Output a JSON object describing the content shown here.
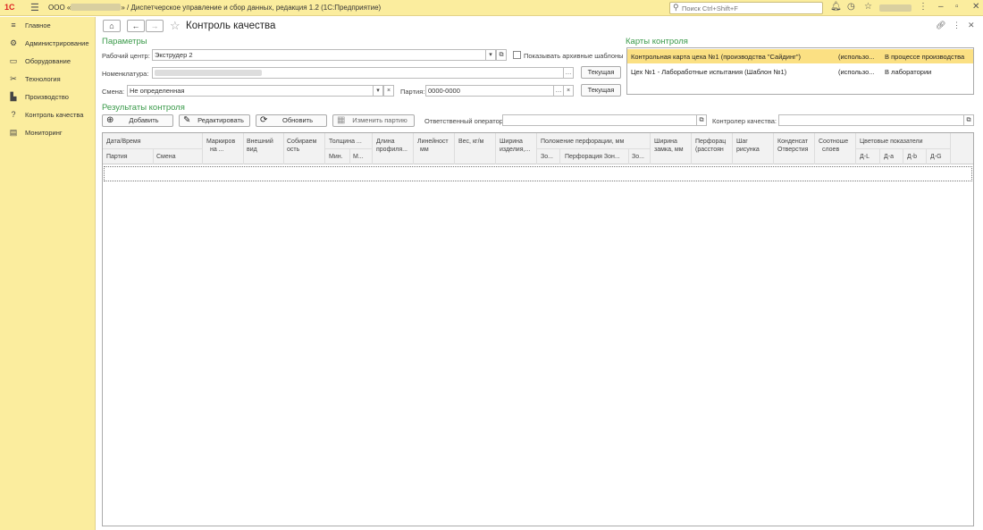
{
  "titlebar": {
    "logo": "1С",
    "title_prefix": "ООО «",
    "title_suffix": "» / Диспетчерское управление и сбор данных, редакция 1.2  (1С:Предприятие)",
    "search_placeholder": "Поиск Ctrl+Shift+F"
  },
  "sidebar": {
    "items": [
      {
        "label": "Главное",
        "icon": "menu-lines-icon"
      },
      {
        "label": "Администрирование",
        "icon": "gear-icon"
      },
      {
        "label": "Оборудование",
        "icon": "monitor-icon"
      },
      {
        "label": "Технология",
        "icon": "tools-icon"
      },
      {
        "label": "Производство",
        "icon": "factory-icon"
      },
      {
        "label": "Контроль качества",
        "icon": "question-circle-icon"
      },
      {
        "label": "Мониторинг",
        "icon": "monitoring-icon"
      }
    ]
  },
  "page": {
    "title": "Контроль качества"
  },
  "params": {
    "section_title": "Параметры",
    "workcenter_label": "Рабочий центр:",
    "workcenter_value": "Экструдер 2",
    "archive_label": "Показывать архивные шаблоны",
    "nomenclature_label": "Номенклатура:",
    "shift_label": "Смена:",
    "shift_value": "Не определенная",
    "batch_label": "Партия:",
    "batch_value": "0000-0000",
    "current_label_1": "Текущая",
    "current_label_2": "Текущая"
  },
  "cards": {
    "section_title": "Карты контроля",
    "rows": [
      {
        "name": "Контрольная карта цеха №1 (производства \"Сайдинг\")",
        "usage": "(использо...",
        "status": "В процессе производства"
      },
      {
        "name": "Цех №1 - Лабоработные испытания (Шаблон №1)",
        "usage": "(использо...",
        "status": "В лаборатории"
      }
    ]
  },
  "results": {
    "section_title": "Результаты контроля",
    "add_label": "Добавить",
    "edit_label": "Редактировать",
    "refresh_label": "Обновить",
    "change_batch_label": "Изменить партию",
    "operator_label": "Ответственный оператор:",
    "inspector_label": "Контролер качества:"
  },
  "table": {
    "headers": {
      "datetime": "Дата/Время",
      "batch": "Партия",
      "shift": "Смена",
      "marking_1": "Маркиров",
      "marking_2": "на ...",
      "appearance_1": "Внешний",
      "appearance_2": "вид",
      "collect_1": "Собираем",
      "collect_2": "ость",
      "thickness": "Толщина ...",
      "thick_min": "Мин.",
      "thick_max": "М...",
      "length_1": "Длина",
      "length_2": "профиля...",
      "linearity_1": "Линейност",
      "linearity_2": "мм",
      "weight": "Вес, кг/м",
      "width_1": "Ширина",
      "width_2": "изделия,...",
      "perf_pos": "Положение перфорации, мм",
      "perf_zone_a": "Зо...",
      "perf_zone_mid": "Перфорация Зон...",
      "perf_zone_b": "Зо...",
      "lock_1": "Ширина",
      "lock_2": "замка, мм",
      "perf_dist_1": "Перфорац",
      "perf_dist_2": "(расстоян",
      "pattern_1": "Шаг",
      "pattern_2": "рисунка",
      "cond_1": "Конденсат",
      "cond_2": "Отверстия",
      "layers_1": "Соотноше",
      "layers_2": "слоев",
      "color": "Цветовые показатели",
      "dl": "Д-L",
      "da": "Д-a",
      "db": "Д-b",
      "dg": "Д-G"
    }
  }
}
